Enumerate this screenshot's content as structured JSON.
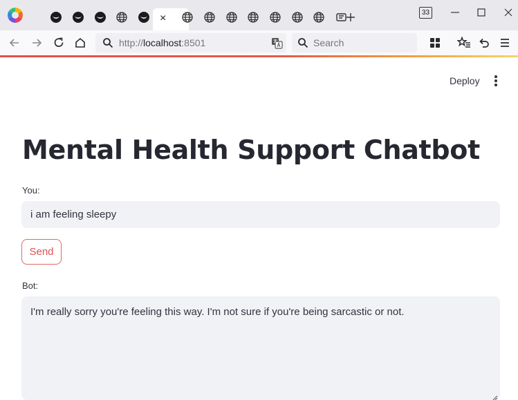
{
  "browser": {
    "tab_count_badge": "33",
    "active_tab_close": "×",
    "url": {
      "scheme": "http://",
      "host": "localhost",
      "port": ":8501"
    },
    "search_placeholder": "Search",
    "accent_gradient": [
      "#e0504e",
      "#f3a042",
      "#f7d46a"
    ]
  },
  "header": {
    "deploy_label": "Deploy"
  },
  "main": {
    "title": "Mental Health Support Chatbot",
    "you_label": "You:",
    "you_value": "i am feeling sleepy",
    "send_label": "Send",
    "bot_label": "Bot:",
    "bot_value": "I'm really sorry you're feeling this way. I'm not sure if you're being sarcastic or not."
  },
  "colors": {
    "primary": "#e0504e",
    "input_bg": "#f0f2f6",
    "text": "#31333f",
    "title": "#262730"
  }
}
